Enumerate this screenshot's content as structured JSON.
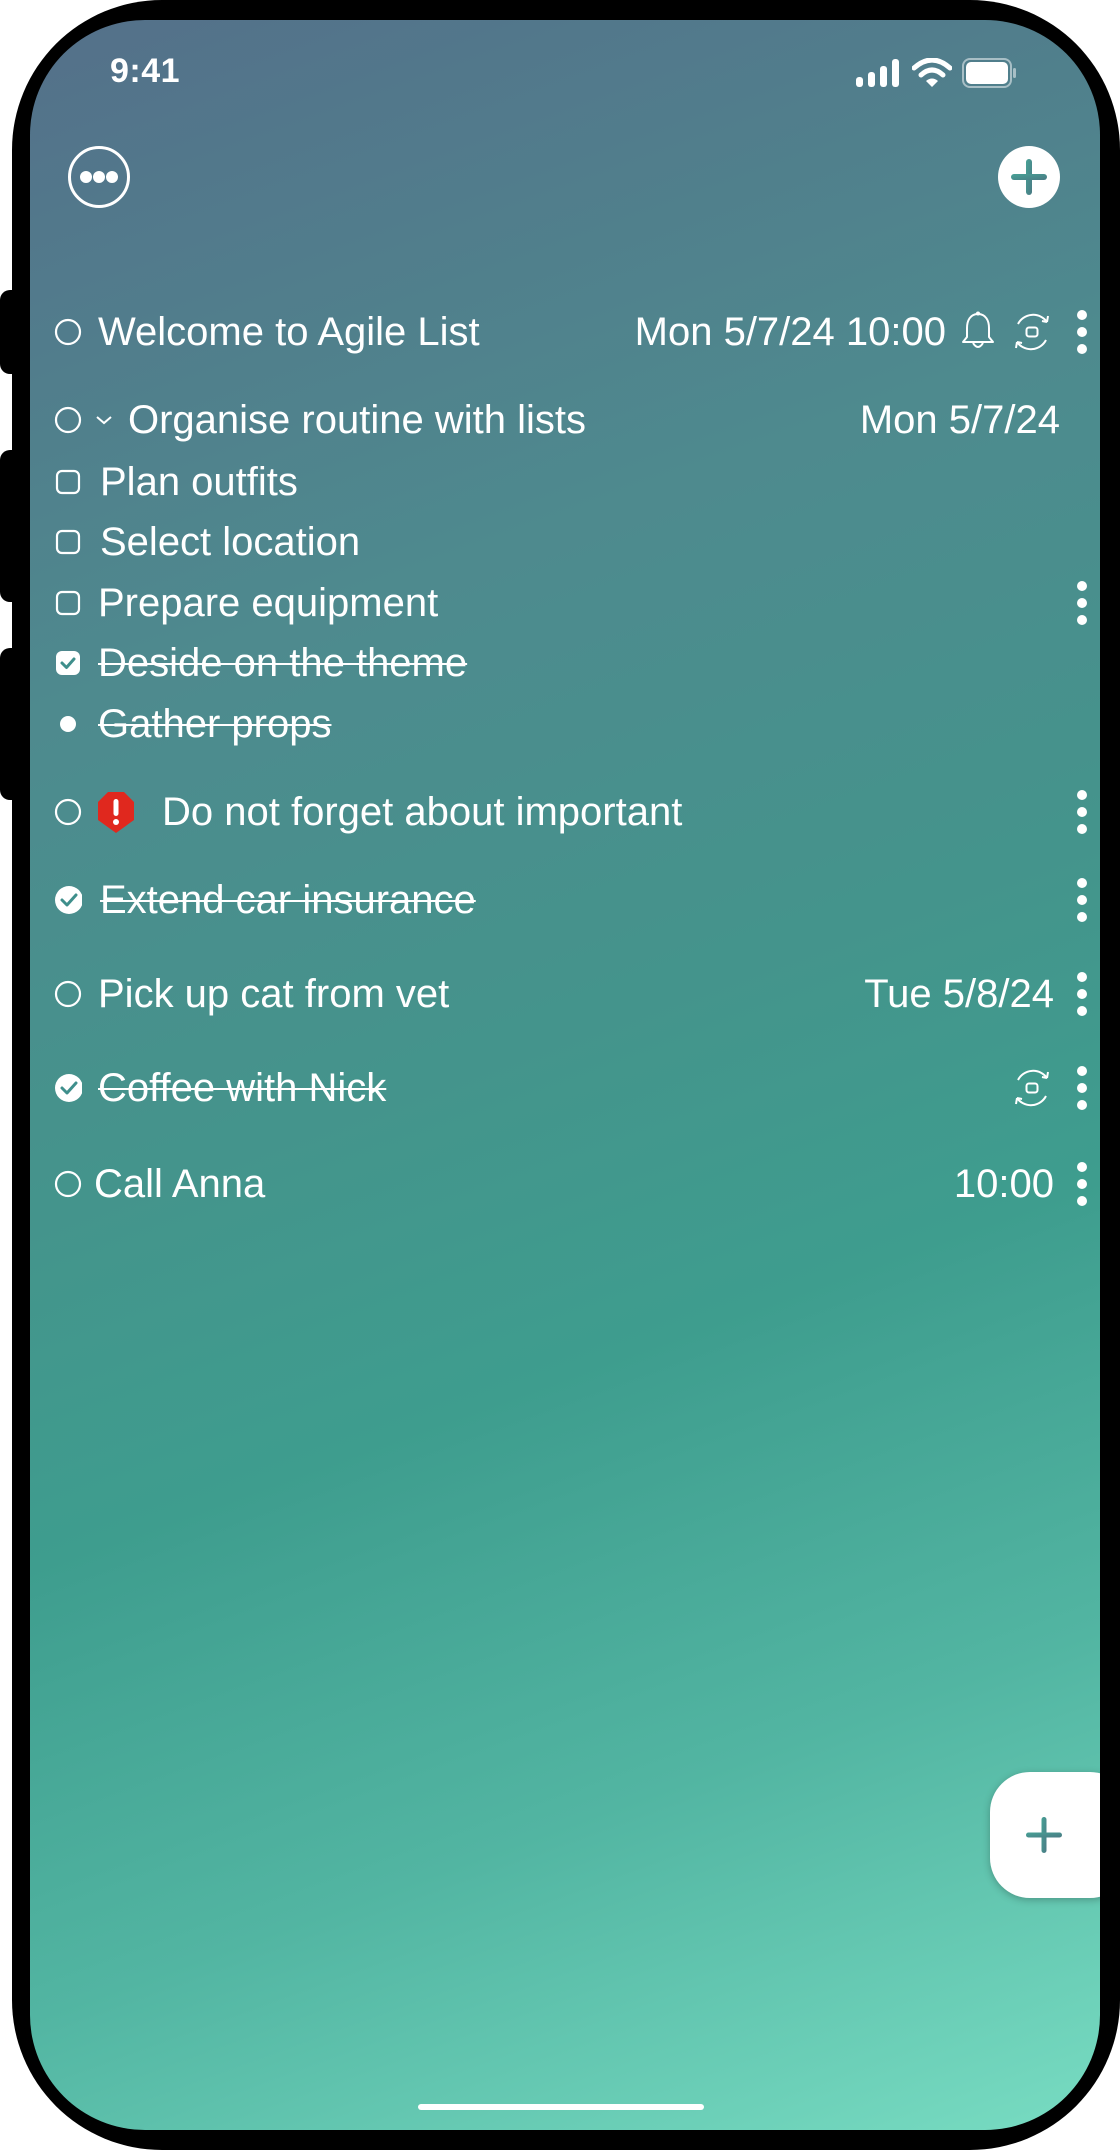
{
  "status_bar": {
    "time": "9:41"
  },
  "header": {
    "more_icon": "ellipsis-circle-icon",
    "add_icon": "plus-circle-icon"
  },
  "colors": {
    "accent": "#3f8f8c",
    "priority_red": "#e0281e",
    "text": "#ffffff"
  },
  "tasks": [
    {
      "title": "Welcome to Agile List",
      "state": "open",
      "date": "Mon 5/7/24 10:00",
      "has_reminder": true,
      "recurring": true
    },
    {
      "title": "Organise routine with lists",
      "state": "open",
      "expanded": true,
      "date": "Mon 5/7/24",
      "subtasks": [
        {
          "title": "Plan outfits",
          "state": "unchecked"
        },
        {
          "title": "Select location",
          "state": "unchecked"
        },
        {
          "title": "Prepare equipment",
          "state": "unchecked"
        },
        {
          "title": "Deside on the theme",
          "state": "checked"
        },
        {
          "title": "Gather props",
          "state": "bullet-done"
        }
      ]
    },
    {
      "title": "Do not forget about important",
      "state": "open",
      "priority": "important"
    },
    {
      "title": "Extend car insurance",
      "state": "done"
    },
    {
      "title": "Pick up cat from vet",
      "state": "open",
      "date": "Tue 5/8/24"
    },
    {
      "title": "Coffee with Nick",
      "state": "done",
      "recurring": true
    },
    {
      "title": "Call Anna",
      "state": "open",
      "date": "10:00"
    }
  ],
  "fab": {
    "icon": "plus-icon"
  }
}
